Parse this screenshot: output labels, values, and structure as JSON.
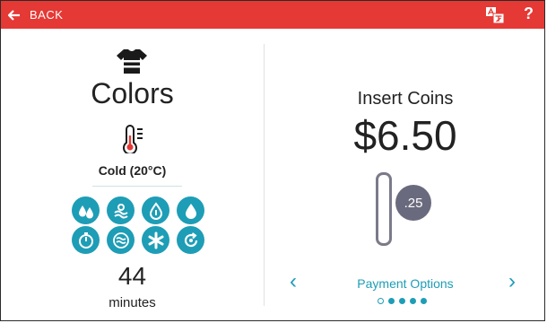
{
  "header": {
    "back_label": "BACK",
    "help_label": "?"
  },
  "cycle": {
    "name": "Colors",
    "temperature": "Cold (20°C)",
    "time_value": "44",
    "time_unit": "minutes"
  },
  "option_icons": [
    "drops-icon",
    "stain-icon",
    "drop-outline-icon",
    "drop-icon",
    "timer-icon",
    "waves-icon",
    "star-icon",
    "refresh-icon"
  ],
  "payment": {
    "prompt": "Insert Coins",
    "amount": "$6.50",
    "coin_label": ".25",
    "options_label": "Payment Options",
    "page_count": 5,
    "current_page": 1
  },
  "colors": {
    "accent": "#1e9db6",
    "topbar": "#e53935",
    "coin": "#6a6a7e"
  }
}
